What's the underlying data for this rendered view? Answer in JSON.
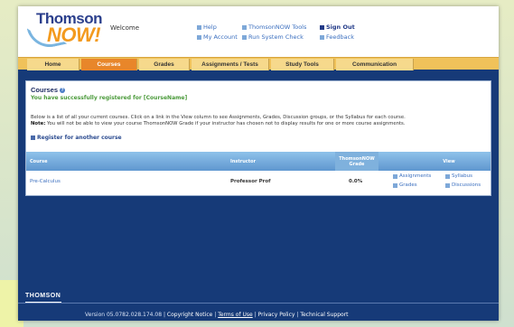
{
  "header": {
    "logo_line1": "Thomson",
    "logo_line2": "NOW!",
    "welcome": "Welcome",
    "links": {
      "help": "Help",
      "tools": "ThomsonNOW Tools",
      "signout": "Sign Out",
      "account": "My Account",
      "systemcheck": "Run System Check",
      "feedback": "Feedback"
    }
  },
  "tabs": [
    "Home",
    "Courses",
    "Grades",
    "Assignments / Tests",
    "Study Tools",
    "Communication"
  ],
  "main": {
    "title": "Courses",
    "success": "You have successfully registered for [CourseName]",
    "info_line1": "Below is a list of all your current courses. Click on a link in the View column to see Assignments, Grades, Discussion groups, or the Syllabus for each course.",
    "info_note_label": "Note:",
    "info_line2": "You will not be able to view your course ThomsonNOW Grade if your instructor has chosen not to display results for one or more course assignments.",
    "register_link": "Register for another course",
    "table": {
      "headers": {
        "course": "Course",
        "instructor": "Instructor",
        "grade_line1": "ThomsonNOW",
        "grade_line2": "Grade",
        "view": "View"
      },
      "rows": [
        {
          "course": "Pre-Calculus",
          "instructor": "Professor Prof",
          "grade": "0.0%",
          "view_links": [
            "Assignments",
            "Syllabus",
            "Grades",
            "Discussions"
          ]
        }
      ]
    }
  },
  "footer": {
    "logo": "THOMSON",
    "version": "Version 05.0782.028.174.08",
    "copyright": "Copyright Notice",
    "terms": "Terms of Use",
    "privacy": "Privacy Policy",
    "support": "Technical Support",
    "separator": "|"
  },
  "colors": {
    "accent_orange": "#e8862a",
    "tab_bar": "#f0c25a",
    "page_background": "#163a78",
    "success_green": "#4a9a3a",
    "table_header": "#5f97cf"
  }
}
